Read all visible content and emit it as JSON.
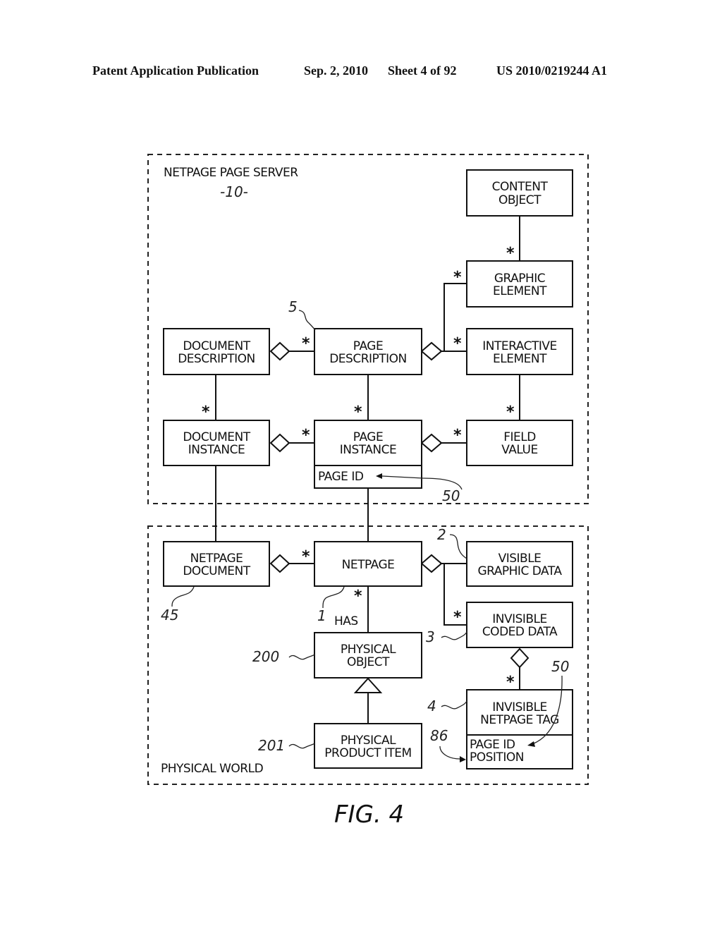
{
  "header": {
    "publication": "Patent Application Publication",
    "date": "Sep. 2, 2010",
    "sheet": "Sheet 4 of 92",
    "number": "US 2010/0219244 A1"
  },
  "regions": {
    "server": {
      "title": "NETPAGE PAGE SERVER",
      "ref": "-10-"
    },
    "physical": {
      "title": "PHYSICAL WORLD"
    }
  },
  "boxes": {
    "content_object": [
      "CONTENT",
      "OBJECT"
    ],
    "graphic_element": [
      "GRAPHIC",
      "ELEMENT"
    ],
    "document_description": [
      "DOCUMENT",
      "DESCRIPTION"
    ],
    "page_description": [
      "PAGE",
      "DESCRIPTION"
    ],
    "interactive_element": [
      "INTERACTIVE",
      "ELEMENT"
    ],
    "document_instance": [
      "DOCUMENT",
      "INSTANCE"
    ],
    "page_instance": [
      "PAGE",
      "INSTANCE"
    ],
    "page_instance_attr": "PAGE ID",
    "field_value": [
      "FIELD",
      "VALUE"
    ],
    "netpage_document": [
      "NETPAGE",
      "DOCUMENT"
    ],
    "netpage": [
      "NETPAGE"
    ],
    "visible_graphic_data": [
      "VISIBLE",
      "GRAPHIC DATA"
    ],
    "invisible_coded_data": [
      "INVISIBLE",
      "CODED DATA"
    ],
    "physical_object": [
      "PHYSICAL",
      "OBJECT"
    ],
    "invisible_netpage_tag": [
      "INVISIBLE",
      "NETPAGE TAG"
    ],
    "invisible_netpage_tag_attrs": [
      "PAGE ID",
      "POSITION"
    ],
    "physical_product_item": [
      "PHYSICAL",
      "PRODUCT ITEM"
    ]
  },
  "multiplicity": "*",
  "association_label": "HAS",
  "refs": {
    "page_description": "5",
    "page_id": "50",
    "netpage_document": "45",
    "netpage": "1",
    "visible_graphic_data": "2",
    "invisible_coded_data": "3",
    "physical_object": "200",
    "invisible_netpage_tag": "4",
    "tag_page_id": "50",
    "tag_position": "86",
    "physical_product_item": "201"
  },
  "figure_label": "FIG. 4"
}
